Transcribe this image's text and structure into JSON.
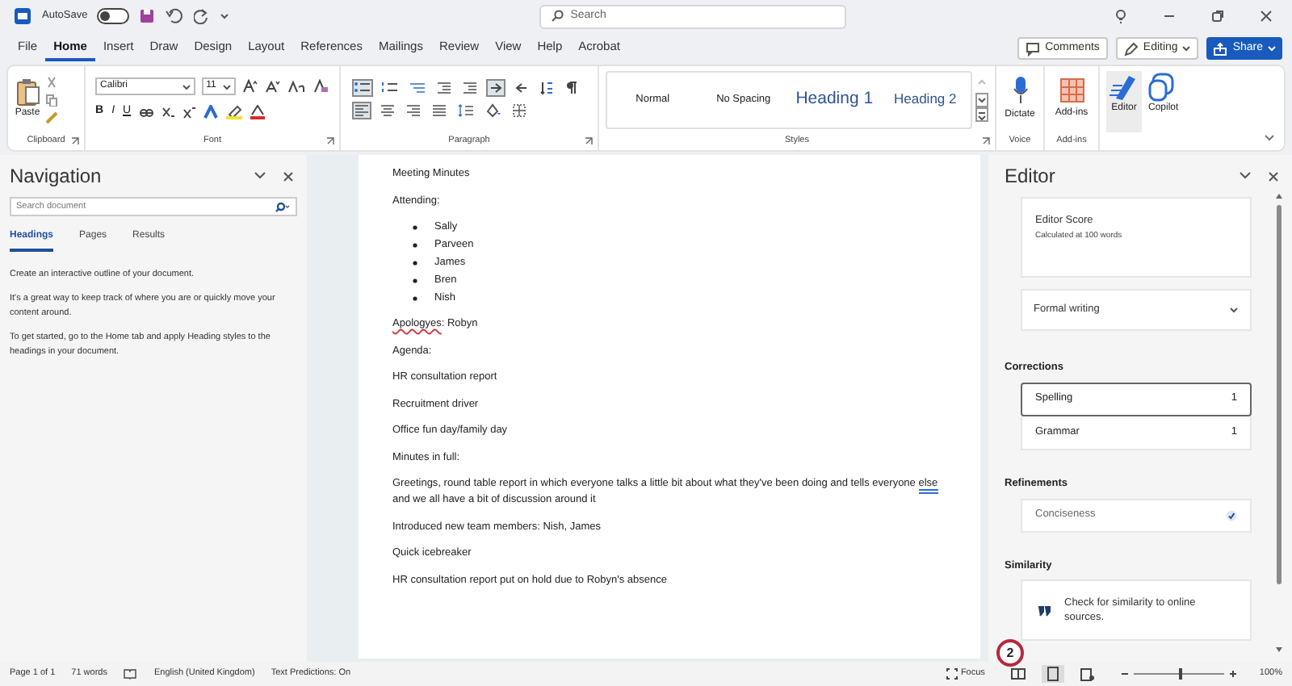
{
  "title_bar": {
    "autosave_label": "AutoSave",
    "autosave_on": false,
    "search_placeholder": "Search"
  },
  "menu_tabs": [
    {
      "label": "File",
      "selected": false
    },
    {
      "label": "Home",
      "selected": true
    },
    {
      "label": "Insert",
      "selected": false
    },
    {
      "label": "Draw",
      "selected": false
    },
    {
      "label": "Design",
      "selected": false
    },
    {
      "label": "Layout",
      "selected": false
    },
    {
      "label": "References",
      "selected": false
    },
    {
      "label": "Mailings",
      "selected": false
    },
    {
      "label": "Review",
      "selected": false
    },
    {
      "label": "View",
      "selected": false
    },
    {
      "label": "Help",
      "selected": false
    },
    {
      "label": "Acrobat",
      "selected": false
    }
  ],
  "top_buttons": [
    {
      "label": "Comments",
      "kind": "comments"
    },
    {
      "label": "Editing",
      "kind": "editing"
    },
    {
      "label": "Share",
      "kind": "share"
    }
  ],
  "ribbon": {
    "clipboard": {
      "paste_label": "Paste",
      "group_label": "Clipboard"
    },
    "font": {
      "font_name": "Calibri",
      "font_size": "11",
      "format_buttons": [
        "B",
        "I",
        "U"
      ],
      "group_label": "Font"
    },
    "paragraph": {
      "group_label": "Paragraph"
    },
    "styles": {
      "items": [
        {
          "label": "Normal",
          "kind": "normal"
        },
        {
          "label": "No Spacing",
          "kind": "normal"
        },
        {
          "label": "Heading 1",
          "kind": "heading1"
        },
        {
          "label": "Heading 2",
          "kind": "heading2"
        }
      ],
      "group_label": "Styles"
    },
    "voice": {
      "button_label": "Dictate",
      "group_label": "Voice"
    },
    "addins": {
      "button_label": "Add-ins",
      "group_label": "Add-ins"
    },
    "tools": [
      {
        "label": "Editor",
        "kind": "editor",
        "selected": true
      },
      {
        "label": "Copilot",
        "kind": "copilot",
        "selected": false
      }
    ]
  },
  "navigation": {
    "title": "Navigation",
    "search_placeholder": "Search document",
    "tabs": [
      {
        "label": "Headings",
        "selected": true
      },
      {
        "label": "Pages",
        "selected": false
      },
      {
        "label": "Results",
        "selected": false
      }
    ],
    "paragraphs": [
      "Create an interactive outline of your document.",
      "It's a great way to keep track of where you are or quickly move your content around.",
      "To get started, go to the Home tab and apply Heading styles to the headings in your document."
    ]
  },
  "document": {
    "blocks": [
      {
        "kind": "para",
        "parts": [
          {
            "text": "Meeting Minutes",
            "spelling_error": false,
            "grammar_error": false
          }
        ]
      },
      {
        "kind": "para",
        "parts": [
          {
            "text": "Attending:",
            "spelling_error": false,
            "grammar_error": false
          }
        ]
      },
      {
        "kind": "bullets",
        "items": [
          "Sally",
          "Parveen",
          "James",
          "Bren",
          "Nish"
        ]
      },
      {
        "kind": "para",
        "parts": [
          {
            "text": "Apologyes",
            "spelling_error": true,
            "grammar_error": false
          },
          {
            "text": ": Robyn",
            "spelling_error": false,
            "grammar_error": false
          }
        ]
      },
      {
        "kind": "para",
        "parts": [
          {
            "text": "Agenda:",
            "spelling_error": false,
            "grammar_error": false
          }
        ]
      },
      {
        "kind": "para",
        "parts": [
          {
            "text": "HR consultation report",
            "spelling_error": false,
            "grammar_error": false
          }
        ]
      },
      {
        "kind": "para",
        "parts": [
          {
            "text": "Recruitment driver",
            "spelling_error": false,
            "grammar_error": false
          }
        ]
      },
      {
        "kind": "para",
        "parts": [
          {
            "text": "Office fun day/family day",
            "spelling_error": false,
            "grammar_error": false
          }
        ]
      },
      {
        "kind": "para",
        "parts": [
          {
            "text": "Minutes in full:",
            "spelling_error": false,
            "grammar_error": false
          }
        ]
      },
      {
        "kind": "para",
        "parts": [
          {
            "text": "Greetings, round table report in which everyone talks a little bit about what they've been doing and tells everyone ",
            "spelling_error": false,
            "grammar_error": false
          },
          {
            "text": "else",
            "spelling_error": false,
            "grammar_error": true
          },
          {
            "text": " and we all have a bit of discussion around it",
            "spelling_error": false,
            "grammar_error": false
          }
        ]
      },
      {
        "kind": "para",
        "parts": [
          {
            "text": "Introduced new team members: Nish, James",
            "spelling_error": false,
            "grammar_error": false
          }
        ]
      },
      {
        "kind": "para",
        "parts": [
          {
            "text": "Quick icebreaker",
            "spelling_error": false,
            "grammar_error": false
          }
        ]
      },
      {
        "kind": "para",
        "parts": [
          {
            "text": "HR consultation report put on hold due to Robyn's absence",
            "spelling_error": false,
            "grammar_error": false
          }
        ]
      }
    ]
  },
  "editor": {
    "title": "Editor",
    "score_title": "Editor Score",
    "score_subtitle": "Calculated at 100 words",
    "writing_style": "Formal writing",
    "corrections_heading": "Corrections",
    "corrections": [
      {
        "label": "Spelling",
        "count": "1",
        "selected": true
      },
      {
        "label": "Grammar",
        "count": "1",
        "selected": false
      }
    ],
    "refinements_heading": "Refinements",
    "refinements": [
      {
        "label": "Conciseness",
        "checked": true
      }
    ],
    "similarity_heading": "Similarity",
    "similarity_text": "Check for similarity to online sources."
  },
  "callout": "2",
  "status_bar": {
    "page": "Page 1 of 1",
    "words": "71 words",
    "language": "English (United Kingdom)",
    "predictions": "Text Predictions: On",
    "focus": "Focus",
    "zoom_slider": {
      "level": 0.5
    },
    "zoom": "100%"
  }
}
